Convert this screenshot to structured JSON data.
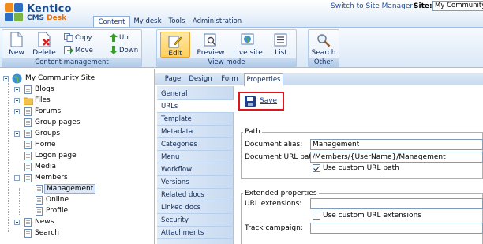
{
  "header": {
    "logo_name": "Kentico",
    "logo_sub_prefix": "CMS",
    "logo_sub_suffix": "Desk",
    "switch_link": "Switch to Site Manager",
    "site_label": "Site:",
    "site_value": "My Community",
    "tabs": [
      {
        "label": "Content",
        "active": true
      },
      {
        "label": "My desk",
        "active": false
      },
      {
        "label": "Tools",
        "active": false
      },
      {
        "label": "Administration",
        "active": false
      }
    ]
  },
  "ribbon": {
    "content_management": {
      "label": "Content management",
      "new": "New",
      "delete": "Delete",
      "copy": "Copy",
      "move": "Move",
      "up": "Up",
      "down": "Down"
    },
    "view_mode": {
      "label": "View mode",
      "edit": "Edit",
      "preview": "Preview",
      "live_site": "Live site",
      "list": "List"
    },
    "other": {
      "label": "Other",
      "search": "Search"
    }
  },
  "tree": {
    "root": "My Community Site",
    "items": [
      {
        "label": "Blogs"
      },
      {
        "label": "Files"
      },
      {
        "label": "Forums"
      },
      {
        "label": "Group pages"
      },
      {
        "label": "Groups"
      },
      {
        "label": "Home"
      },
      {
        "label": "Logon page"
      },
      {
        "label": "Media"
      },
      {
        "label": "Members"
      },
      {
        "label": "Management"
      },
      {
        "label": "Online"
      },
      {
        "label": "Profile"
      },
      {
        "label": "News"
      },
      {
        "label": "Search"
      }
    ]
  },
  "subtabs": [
    {
      "label": "Page"
    },
    {
      "label": "Design"
    },
    {
      "label": "Form"
    },
    {
      "label": "Properties"
    }
  ],
  "vnav": [
    {
      "label": "General"
    },
    {
      "label": "URLs"
    },
    {
      "label": "Template"
    },
    {
      "label": "Metadata"
    },
    {
      "label": "Categories"
    },
    {
      "label": "Menu"
    },
    {
      "label": "Workflow"
    },
    {
      "label": "Versions"
    },
    {
      "label": "Related docs"
    },
    {
      "label": "Linked docs"
    },
    {
      "label": "Security"
    },
    {
      "label": "Attachments"
    }
  ],
  "form": {
    "save_label": "Save",
    "path_legend": "Path",
    "alias_label": "Document alias:",
    "alias_value": "Management",
    "url_path_label": "Document URL path:",
    "url_path_value": "/Members/{UserName}/Management",
    "use_custom_url_path": "Use custom URL path",
    "use_custom_url_path_checked": true,
    "extended_legend": "Extended properties",
    "url_ext_label": "URL extensions:",
    "url_ext_value": "",
    "use_custom_url_ext": "Use custom URL extensions",
    "use_custom_url_ext_checked": false,
    "track_label": "Track campaign:",
    "track_value": ""
  }
}
